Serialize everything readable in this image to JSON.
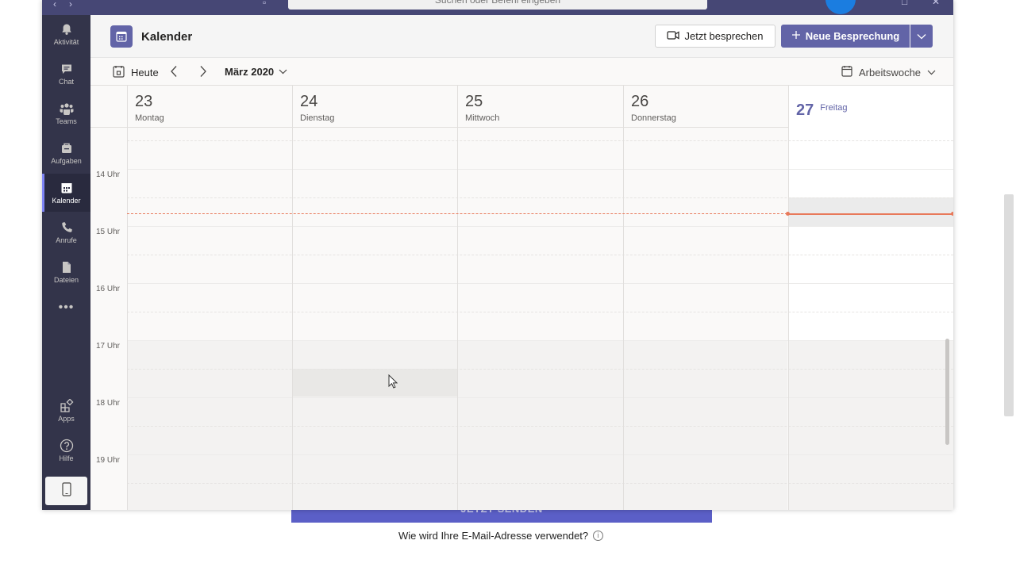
{
  "search": {
    "placeholder": "Suchen oder Befehl eingeben"
  },
  "rail": {
    "items": [
      {
        "label": "Aktivität",
        "icon": "bell-icon"
      },
      {
        "label": "Chat",
        "icon": "chat-icon"
      },
      {
        "label": "Teams",
        "icon": "teams-icon"
      },
      {
        "label": "Aufgaben",
        "icon": "briefcase-icon"
      },
      {
        "label": "Kalender",
        "icon": "calendar-icon",
        "active": true
      },
      {
        "label": "Anrufe",
        "icon": "phone-icon"
      },
      {
        "label": "Dateien",
        "icon": "file-icon"
      }
    ],
    "more": "•••",
    "bottom": [
      {
        "label": "Apps",
        "icon": "apps-icon"
      },
      {
        "label": "Hilfe",
        "icon": "help-icon"
      }
    ]
  },
  "header": {
    "title": "Kalender",
    "meet_now": "Jetzt besprechen",
    "new_meeting": "Neue Besprechung"
  },
  "toolbar": {
    "today": "Heute",
    "month": "März 2020",
    "view": "Arbeitswoche"
  },
  "days": [
    {
      "num": "23",
      "name": "Montag"
    },
    {
      "num": "24",
      "name": "Dienstag"
    },
    {
      "num": "25",
      "name": "Mittwoch"
    },
    {
      "num": "26",
      "name": "Donnerstag"
    },
    {
      "num": "27",
      "name": "Freitag",
      "today": true
    }
  ],
  "hours": [
    "14 Uhr",
    "15 Uhr",
    "16 Uhr",
    "17 Uhr",
    "18 Uhr",
    "19 Uhr"
  ],
  "background_page": {
    "button": "JETZT SENDEN",
    "question": "Wie wird Ihre E-Mail-Adresse verwendet?"
  },
  "colors": {
    "rail": "#33344a",
    "accent": "#6264a7",
    "now_line": "#e8795a"
  }
}
